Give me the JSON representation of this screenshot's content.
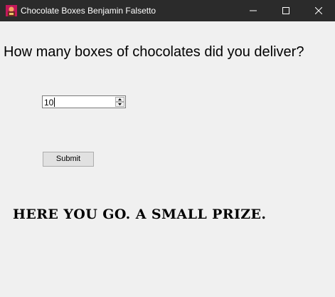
{
  "window": {
    "title": "Chocolate Boxes Benjamin Falsetto",
    "icon": "app-icon",
    "controls": [
      "minimize-icon",
      "maximize-icon",
      "close-icon"
    ]
  },
  "form": {
    "question": "How many boxes of chocolates did you deliver?",
    "quantity_value": "10",
    "submit_label": "Submit"
  },
  "message": {
    "text": "HERE YOU GO. A SMALL PRIZE."
  },
  "colors": {
    "titlebar": "#2b2b2b",
    "background": "#f0f0f0"
  }
}
